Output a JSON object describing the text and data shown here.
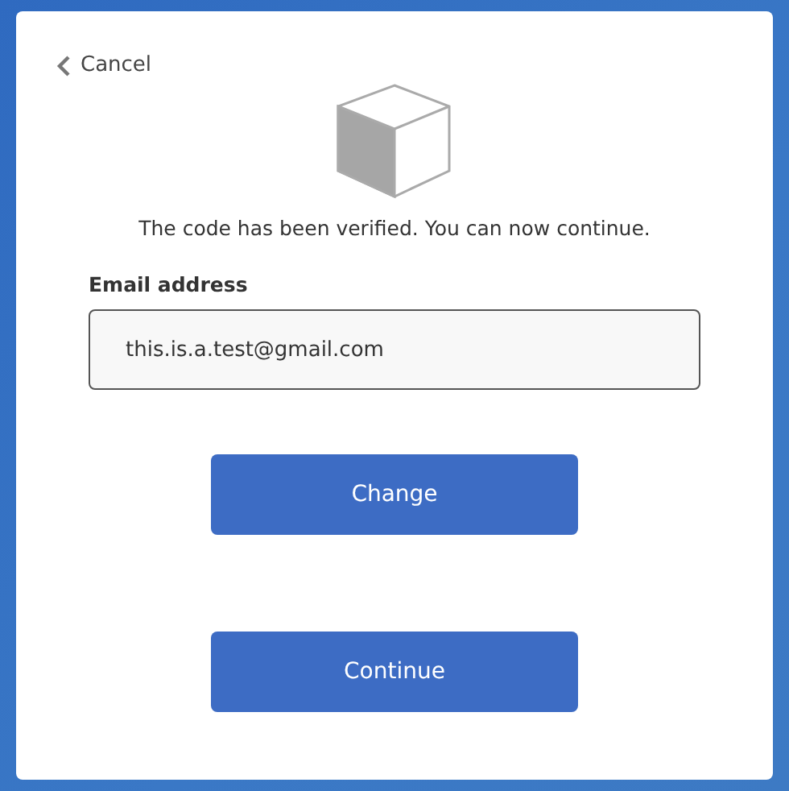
{
  "back_link": {
    "label": "Cancel"
  },
  "message": "The code has been verified. You can now continue.",
  "email_field": {
    "label": "Email address",
    "value": "this.is.a.test@gmail.com"
  },
  "buttons": [
    {
      "label": "Change"
    },
    {
      "label": "Continue"
    }
  ]
}
